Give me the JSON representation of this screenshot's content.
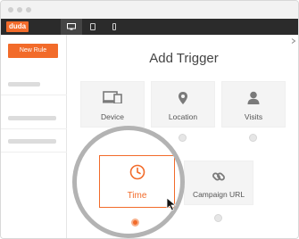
{
  "app": {
    "logo_text": "duda"
  },
  "sidebar": {
    "new_rule_label": "New Rule"
  },
  "main": {
    "title": "Add Trigger",
    "triggers": [
      {
        "label": "Device",
        "icon": "devices-icon",
        "selected": false
      },
      {
        "label": "Location",
        "icon": "location-pin-icon",
        "selected": false
      },
      {
        "label": "Visits",
        "icon": "user-icon",
        "selected": false
      },
      {
        "label": "Time",
        "icon": "clock-icon",
        "selected": true
      },
      {
        "label": "Campaign URL",
        "icon": "link-icon",
        "selected": false
      }
    ]
  },
  "colors": {
    "accent": "#f26b2a",
    "toolbar": "#2b2b2b",
    "card": "#f4f4f4",
    "text": "#555555"
  }
}
